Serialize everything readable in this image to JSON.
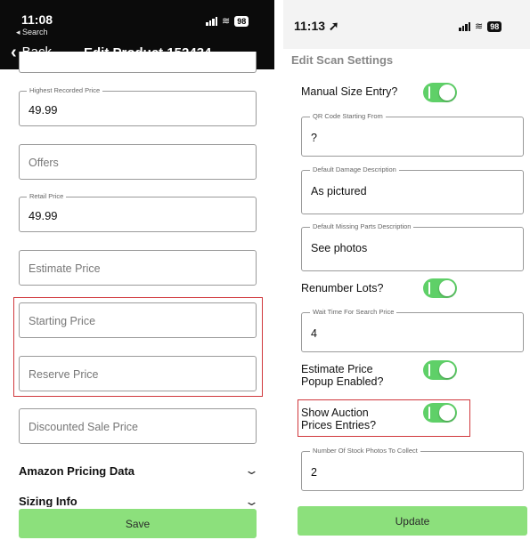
{
  "left": {
    "status": {
      "time": "11:08",
      "back_app": "◂ Search",
      "battery": "98"
    },
    "nav": {
      "back_label": "Back",
      "title": "Edit Product 152434"
    },
    "fields": {
      "highest_price": {
        "label": "Highest Recorded Price",
        "value": "49.99"
      },
      "offers": {
        "placeholder": "Offers"
      },
      "retail_price": {
        "label": "Retail Price",
        "value": "49.99"
      },
      "estimate_price": {
        "placeholder": "Estimate Price"
      },
      "starting_price": {
        "placeholder": "Starting Price"
      },
      "reserve_price": {
        "placeholder": "Reserve Price"
      },
      "discounted_price": {
        "placeholder": "Discounted Sale Price"
      }
    },
    "sections": {
      "amazon": "Amazon Pricing Data",
      "sizing": "Sizing Info"
    },
    "save_label": "Save"
  },
  "right": {
    "status": {
      "time": "11:13 ➚",
      "battery": "98"
    },
    "title": "Edit Scan Settings",
    "manual_size": {
      "label": "Manual Size Entry?",
      "on": true
    },
    "qr_start": {
      "label": "QR Code Starting From",
      "value": "?"
    },
    "damage_desc": {
      "label": "Default Damage Description",
      "value": "As pictured"
    },
    "missing_desc": {
      "label": "Default Missing Parts Description",
      "value": "See photos"
    },
    "renumber": {
      "label": "Renumber Lots?",
      "on": true
    },
    "wait_time": {
      "label": "Wait Time For Search Price",
      "value": "4"
    },
    "estimate_popup": {
      "label_line1": "Estimate Price",
      "label_line2": "Popup Enabled?",
      "on": true
    },
    "show_auction": {
      "label_line1": "Show Auction",
      "label_line2": "Prices Entries?",
      "on": true
    },
    "stock_photos": {
      "label": "Number Of Stock Photos To Collect",
      "value": "2"
    },
    "update_label": "Update"
  },
  "colors": {
    "toggle_on": "#5fd068",
    "button_green": "#8ce07c",
    "highlight_red": "#d0373c",
    "topbar_dark": "#0b0b0b"
  }
}
